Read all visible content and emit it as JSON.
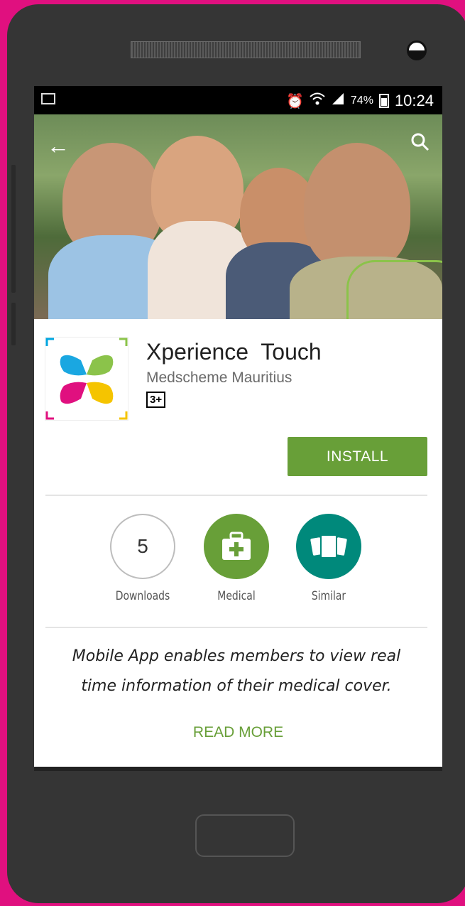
{
  "statusbar": {
    "battery": "74%",
    "time": "10:24"
  },
  "app": {
    "title": "Xperience  Touch",
    "developer": "Medscheme Mauritius",
    "rating": "3+",
    "install_label": "INSTALL"
  },
  "badges": [
    {
      "value": "5",
      "label": "Downloads"
    },
    {
      "label": "Medical",
      "icon": "medical-kit-icon",
      "color": "#689f38"
    },
    {
      "label": "Similar",
      "icon": "similar-apps-icon",
      "color": "#00897b"
    }
  ],
  "description": {
    "line1": "Mobile App enables members to view real",
    "line2": "time information of their medical cover."
  },
  "read_more_label": "READ MORE",
  "colors": {
    "accent": "#689f38",
    "teal": "#00897b",
    "frame": "#e0107f"
  }
}
